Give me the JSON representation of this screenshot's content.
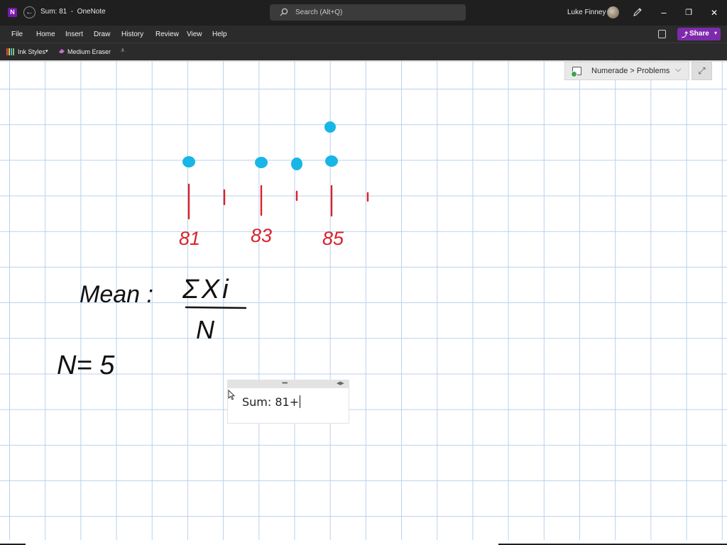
{
  "window": {
    "app_badge": "N",
    "title": "Sum: 81  -  OneNote",
    "search_placeholder": "Search (Alt+Q)",
    "user_name": "Luke Finney",
    "controls": {
      "minimize": "–",
      "restore": "❐",
      "close": "✕"
    }
  },
  "menu": {
    "items": [
      "File",
      "Home",
      "Insert",
      "Draw",
      "History",
      "Review",
      "View",
      "Help"
    ],
    "share_label": "Share"
  },
  "ink_toolbar": {
    "ink_styles_label": "Ink Styles",
    "eraser_label": "Medium Eraser"
  },
  "page": {
    "breadcrumb": "Numerade > Problems",
    "note_text": "Sum: 81+"
  },
  "handwriting": {
    "tick_labels": [
      "81",
      "83",
      "85"
    ],
    "mean_label": "Mean :",
    "formula_numerator": "ΣXi",
    "formula_denominator": "N",
    "n_equation": "N= 5",
    "dot_plot": [
      {
        "value": 81,
        "count": 1
      },
      {
        "value": 83,
        "count": 1
      },
      {
        "value": 84,
        "count": 1
      },
      {
        "value": 85,
        "count": 2
      }
    ]
  },
  "colors": {
    "titlebar": "#1f1f1f",
    "menubar": "#2b2b2b",
    "share": "#7e2aab",
    "gridline": "#b9d1ec",
    "ink_blue": "#17b6e6",
    "ink_red": "#d9232b",
    "ink_black": "#111111"
  }
}
